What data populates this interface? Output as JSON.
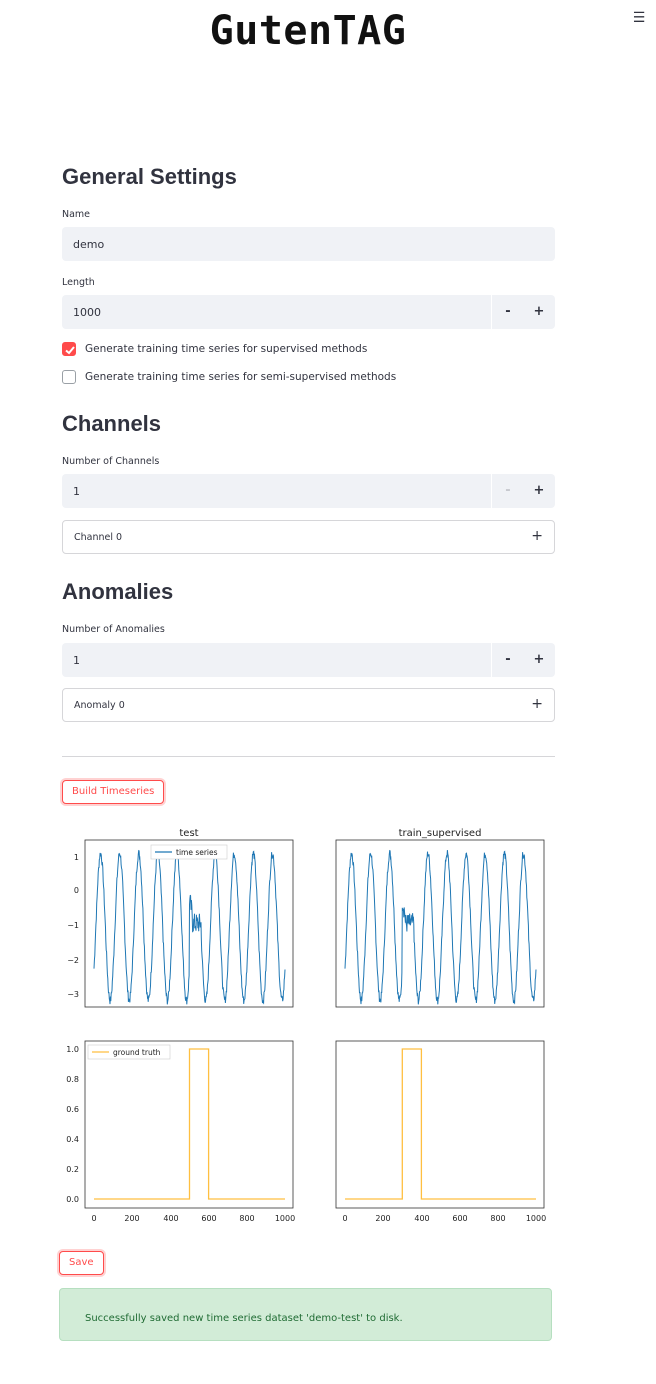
{
  "app": {
    "title": "GutenTAG",
    "menu_icon": "hamburger-icon"
  },
  "general": {
    "heading": "General Settings",
    "name_label": "Name",
    "name_value": "demo",
    "length_label": "Length",
    "length_value": "1000",
    "minus": "-",
    "plus": "+",
    "checkbox_supervised": {
      "label": "Generate training time series for supervised methods",
      "checked": true
    },
    "checkbox_semi": {
      "label": "Generate training time series for semi-supervised methods",
      "checked": false
    }
  },
  "channels": {
    "heading": "Channels",
    "count_label": "Number of Channels",
    "count_value": "1",
    "expander_label": "Channel 0",
    "expander_icon": "+"
  },
  "anomalies": {
    "heading": "Anomalies",
    "count_label": "Number of Anomalies",
    "count_value": "1",
    "expander_label": "Anomaly 0",
    "expander_icon": "+"
  },
  "actions": {
    "build_label": "Build Timeseries",
    "save_label": "Save"
  },
  "status": {
    "success_message": "Successfully saved new time series dataset 'demo-test' to disk."
  },
  "colors": {
    "accent": "#ff4b4b",
    "series": "#1f77b4",
    "ground_truth": "#ffbf40",
    "success_bg": "#d2ecd7"
  },
  "chart_data": [
    {
      "type": "line",
      "title": "test",
      "legend": [
        "time series"
      ],
      "legend_position": "top-center",
      "ylim": [
        -3.2,
        1.2
      ],
      "yticks": [
        "1",
        "0",
        "−1",
        "−2",
        "−3"
      ],
      "x": [
        0,
        1000
      ],
      "series": [
        {
          "name": "time series",
          "description_values": {
            "period": 100,
            "amplitude": 2.1,
            "offset": -1.0,
            "anomaly_range": [
              500,
              600
            ]
          }
        }
      ]
    },
    {
      "type": "line",
      "title": "train_supervised",
      "ylim": [
        -3.2,
        1.2
      ],
      "x": [
        0,
        1000
      ],
      "series": [
        {
          "description_values": {
            "period": 100,
            "amplitude": 2.1,
            "offset": -1.0,
            "anomaly_range": [
              300,
              400
            ]
          }
        }
      ]
    },
    {
      "type": "line",
      "title": "",
      "legend": [
        "ground truth"
      ],
      "legend_position": "top-left",
      "ylim": [
        0,
        1.0
      ],
      "yticks": [
        "1.0",
        "0.8",
        "0.6",
        "0.4",
        "0.2",
        "0.0"
      ],
      "xticks": [
        "0",
        "200",
        "400",
        "600",
        "800",
        "1000"
      ],
      "series": [
        {
          "name": "ground truth",
          "x": [
            0,
            500,
            500,
            600,
            600,
            1000
          ],
          "y": [
            0,
            0,
            1,
            1,
            0,
            0
          ]
        }
      ]
    },
    {
      "type": "line",
      "title": "",
      "ylim": [
        0,
        1.0
      ],
      "xticks": [
        "0",
        "200",
        "400",
        "600",
        "800",
        "1000"
      ],
      "series": [
        {
          "x": [
            0,
            300,
            300,
            400,
            400,
            1000
          ],
          "y": [
            0,
            0,
            1,
            1,
            0,
            0
          ]
        }
      ]
    }
  ]
}
